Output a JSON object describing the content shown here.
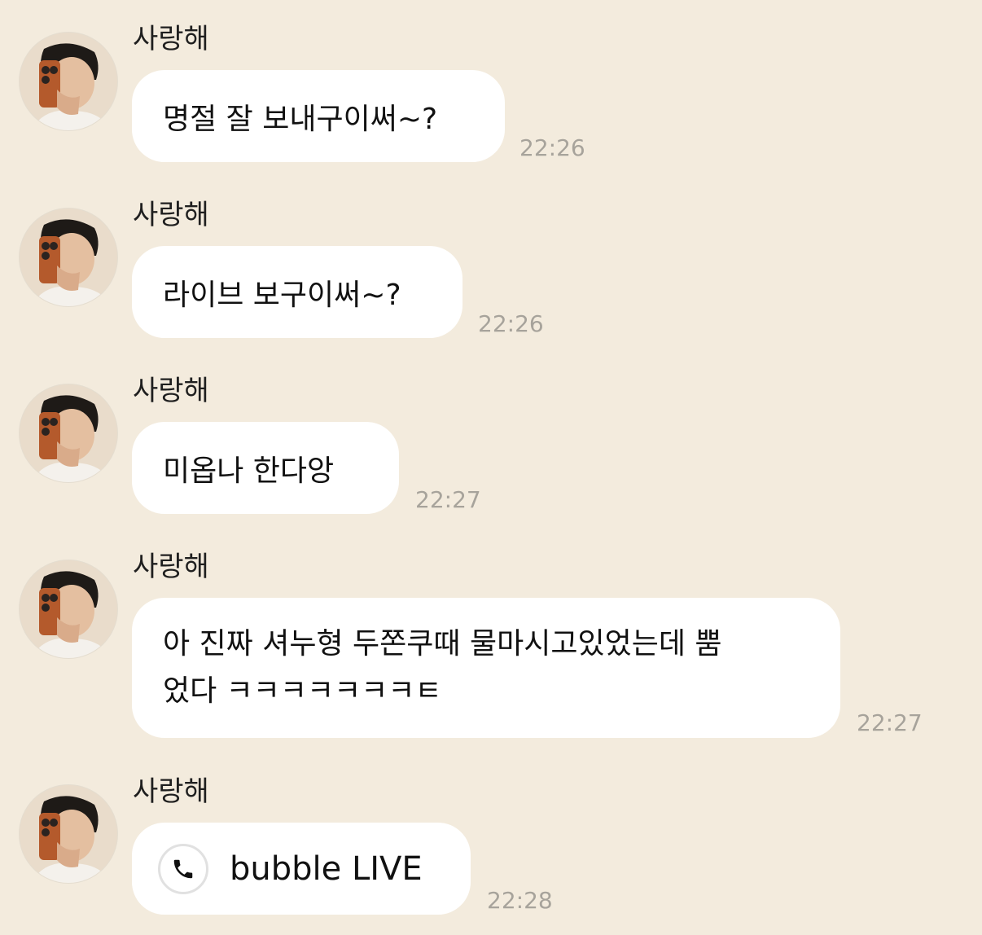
{
  "messages": [
    {
      "sender": "사랑해",
      "text": "명절 잘 보내구이써~?",
      "time": "22:26"
    },
    {
      "sender": "사랑해",
      "text": "라이브 보구이써~?",
      "time": "22:26"
    },
    {
      "sender": "사랑해",
      "text": "미옵나 한다앙",
      "time": "22:27"
    },
    {
      "sender": "사랑해",
      "line1": "아 진짜 셔누형 두쫀쿠때 물마시고있었는데 뿜",
      "line2": "었다 ㅋㅋㅋㅋㅋㅋㅋㅌ",
      "time": "22:27"
    },
    {
      "sender": "사랑해",
      "text": "bubble LIVE",
      "icon": "phone-icon",
      "time": "22:28"
    }
  ],
  "colors": {
    "background": "#f3ebdd",
    "bubble": "#ffffff",
    "time": "#a7a39b"
  }
}
